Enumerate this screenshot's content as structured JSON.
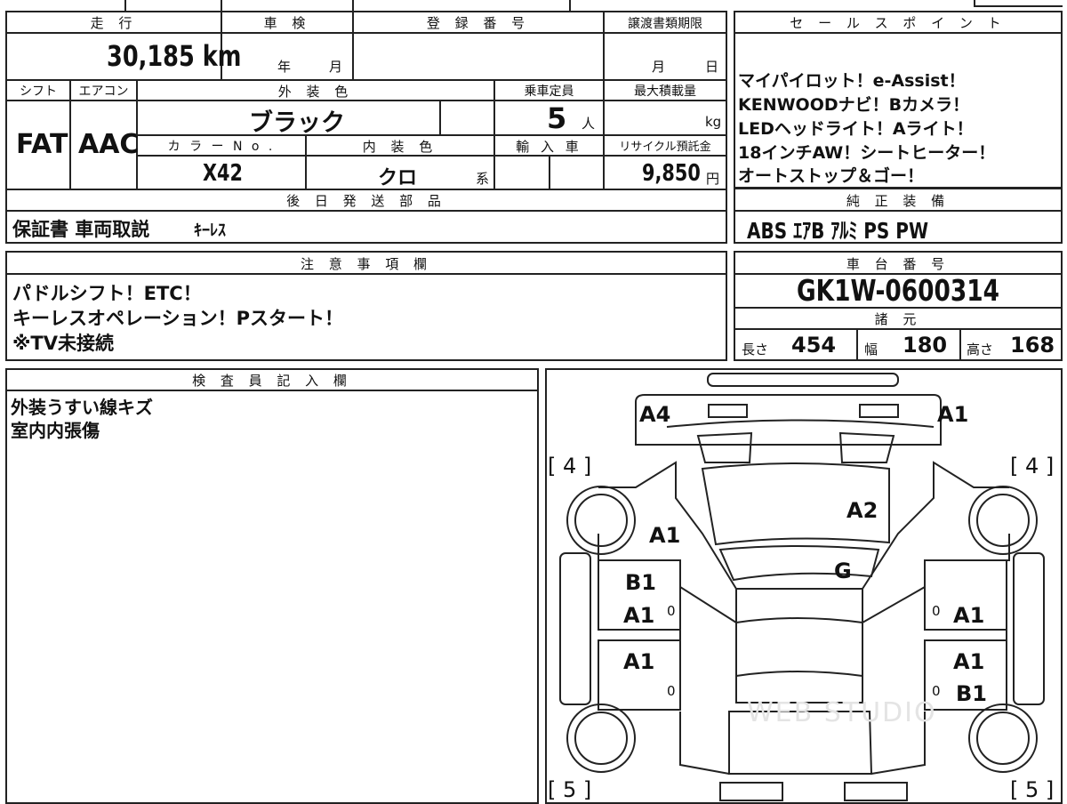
{
  "main_sheet": {
    "mileage_label": "走 行",
    "mileage_value": "30,185 km",
    "inspection_label": "車 検",
    "inspection_year_unit": "年",
    "inspection_month_unit": "月",
    "registration_label": "登 録 番 号",
    "transfer_deadline_label": "譲渡書類期限",
    "transfer_month_unit": "月",
    "transfer_day_unit": "日",
    "shift_label": "シフト",
    "shift_value": "FAT",
    "ac_label": "エアコン",
    "ac_value": "AAC",
    "exterior_color_label": "外 装 色",
    "exterior_color_value": "ブラック",
    "capacity_label": "乗車定員",
    "capacity_value": "5",
    "capacity_unit": "人",
    "max_load_label": "最大積載量",
    "max_load_unit": "kg",
    "color_no_label": "カ ラ ー N o .",
    "color_no_value": "X42",
    "interior_color_label": "内 装 色",
    "interior_color_value": "クロ",
    "interior_color_suffix": "系",
    "import_label": "輸 入 車",
    "recycle_label": "リサイクル預託金",
    "recycle_value": "9,850",
    "recycle_unit": "円",
    "later_parts_label": "後 日 発 送 部 品",
    "later_parts_value": "保証書 車両取説",
    "later_parts_extra": "ｷｰﾚｽ"
  },
  "sales_points": {
    "label": "セ ー ル ス ポ イ ン ト",
    "lines": [
      "マイパイロット！e-Assist！",
      "KENWOODナビ！Bカメラ！",
      "LEDヘッドライト！Aライト！",
      "18インチAW！シートヒーター！",
      "オートストップ＆ゴー！"
    ]
  },
  "standard_equipment": {
    "label": "純 正 装 備",
    "value": "ABS ｴｱB ｱﾙﾐ PS PW"
  },
  "notes": {
    "label": "注 意 事 項 欄",
    "lines": [
      "パドルシフト！ETC！",
      "キーレスオペレーション！Pスタート！",
      "※TV未接続"
    ]
  },
  "chassis": {
    "label": "車 台 番 号",
    "value": "GK1W-0600314"
  },
  "dimensions": {
    "label": "諸 元",
    "length_label": "長さ",
    "length_value": "454",
    "width_label": "幅",
    "width_value": "180",
    "height_label": "高さ",
    "height_value": "168"
  },
  "inspector": {
    "label": "検 査 員 記 入 欄",
    "lines": [
      "外装うすい線キズ",
      "室内内張傷"
    ]
  },
  "diagram": {
    "marks": {
      "a4_front_left": "A4",
      "a1_front_right": "A1",
      "bracket_fl": "[ 4 ]",
      "bracket_fr": "[ 4 ]",
      "a1_left_fender": "A1",
      "a2_windshield": "A2",
      "g_windshield": "G",
      "b1_left_front_door": "B1",
      "a1_left_front_door": "A1",
      "a1_right_front_door": "A1",
      "a1_left_rear_door": "A1",
      "a1_right_rear_door": "A1",
      "b1_right_rear_door": "B1",
      "bracket_rl": "[ 5 ]",
      "bracket_rr": "[ 5 ]",
      "zero": "0"
    },
    "watermark": "WEB STUDIO"
  }
}
